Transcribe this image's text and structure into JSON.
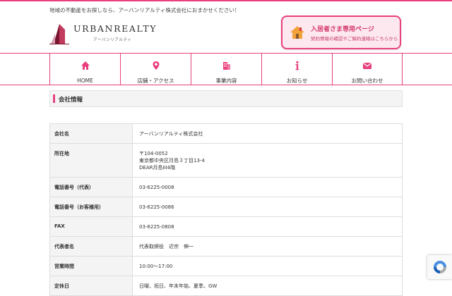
{
  "header": {
    "tagline": "地域の不動産をお探しなら、アーバンリアルティ株式会社におまかせください！",
    "logo_text": "URBANREALTY",
    "logo_sub": "アーバンリアルティ"
  },
  "tenant_banner": {
    "title": "入居者さま専用ページ",
    "desc": "契約情報の確認やご解約連絡はこちらから"
  },
  "nav": {
    "items": [
      {
        "label": "HOME",
        "icon": "home-icon"
      },
      {
        "label": "店舗・アクセス",
        "icon": "map-pin-icon"
      },
      {
        "label": "事業内容",
        "icon": "building-icon"
      },
      {
        "label": "お知らせ",
        "icon": "info-icon"
      },
      {
        "label": "お問い合わせ",
        "icon": "mail-icon"
      }
    ]
  },
  "section": {
    "title": "会社情報"
  },
  "company": {
    "rows": [
      {
        "label": "会社名",
        "value": "アーバンリアルティ株式会社"
      },
      {
        "label": "所在地",
        "lines": [
          "〒104-0052",
          "東京都中央区月島３丁目13-4",
          "DEAR月島III4階"
        ]
      },
      {
        "label": "電話番号（代表）",
        "value": "03-6225-0008"
      },
      {
        "label": "電話番号（お客様用）",
        "value": "03-6225-0086"
      },
      {
        "label": "FAX",
        "value": "03-6225-0808"
      },
      {
        "label": "代表者名",
        "value": "代表取締役　近宗　伸一"
      },
      {
        "label": "営業時間",
        "value": "10:00〜17:00"
      },
      {
        "label": "定休日",
        "value": "日曜、祝日、年末年始、夏季、GW"
      }
    ]
  },
  "colors": {
    "accent": "#e8407e",
    "banner_bg": "#fde8ef"
  }
}
